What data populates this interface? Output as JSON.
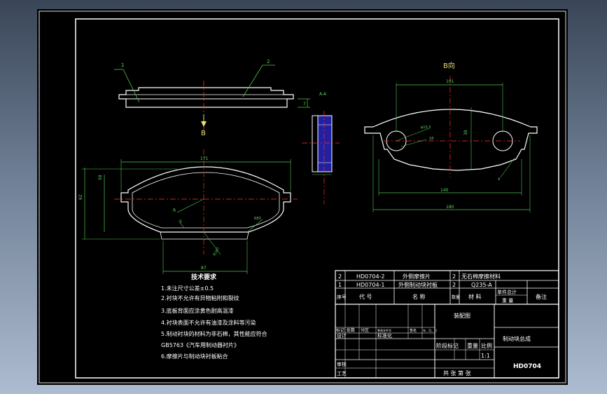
{
  "drawing": {
    "leader_1": "1",
    "leader_2": "2",
    "section_label": "A-A",
    "thickness_dim": "7",
    "b_arrow_label": "B",
    "b_view_title": "B向",
    "dim_plate_width": "171",
    "dim_plate_height": "62",
    "dim_inner_height": "58",
    "dim_radius_r": "R",
    "dim_bottom_width": "87",
    "dim_r83": "R83",
    "dim_r167": "R167",
    "dim_3": "3",
    "dim_bview_top": "101",
    "dim_bview_height": "38",
    "dim_bview_140": "140",
    "dim_bview_180": "180",
    "dim_hole_phi": "φ15.5",
    "dim_hole_18": "18",
    "dim_bview_a": "A"
  },
  "notes": {
    "heading": "技术要求",
    "items": [
      "1.未注尺寸公差±0.5",
      "2.衬块不允许有异物粘附和裂纹",
      "3.底板背面应涂黄色耐高温漆",
      "4.衬块表面不允许有油漆及涂料等污染",
      "5.制动衬块的材料为非石棉，其性能应符合",
      "GB5763《汽车用制动器衬片》",
      "6.摩擦片与制动块衬板粘合"
    ]
  },
  "title_block": {
    "parts": [
      {
        "seq": "2",
        "code": "HD0704-2",
        "name": "外侧摩擦片",
        "qty": "2",
        "material": "无石棉摩擦材料"
      },
      {
        "seq": "1",
        "code": "HD0704-1",
        "name": "外侧制动块衬板",
        "qty": "2",
        "material": "Q235-A"
      }
    ],
    "headers": {
      "seq": "序号",
      "code": "代 号",
      "name": "名 称",
      "qty": "数量",
      "material": "材 料",
      "unit_total": "单件总计",
      "weight": "重 量",
      "remarks": "备注"
    },
    "assembly_label": "装配图",
    "revision_row": [
      "标记",
      "处数",
      "分区",
      "更改文件号",
      "签名",
      "年、月、日"
    ],
    "design": "设计",
    "standardization": "标准化",
    "stage_mark": "阶段标记",
    "weight_label": "重量",
    "scale_label": "比例",
    "scale_value": "1:1",
    "review": "审核",
    "process": "工艺",
    "sheets": "共 张 第 张",
    "product_name": "制动块总成",
    "drawing_number": "HD0704"
  }
}
